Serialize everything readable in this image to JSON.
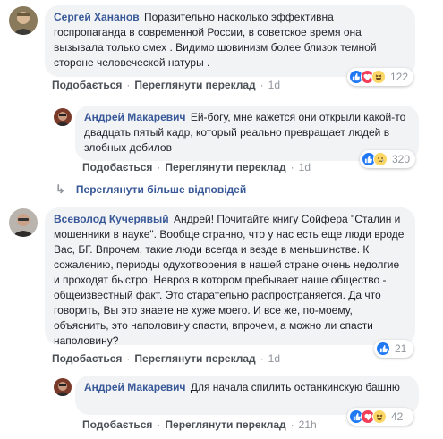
{
  "comments": [
    {
      "author": "Сергей Хананов",
      "text": "Поразительно насколько эффективна госпропаганда в современной России, в советское время она вызывала только смех . Видимо шовинизм более близок темной стороне человеческой натуры .",
      "actions": [
        "Подобається",
        "Переглянути переклад"
      ],
      "time": "1d",
      "reactions": [
        "like",
        "love",
        "haha"
      ],
      "reaction_count": "122"
    },
    {
      "author": "Андрей Макаревич",
      "text": "Ей-богу, мне кажется они открыли какой-то двадцать пятый кадр, который реально превращает людей в злобных дебилов",
      "actions": [
        "Подобається",
        "Переглянути переклад"
      ],
      "time": "1d",
      "reactions": [
        "like",
        "sad"
      ],
      "reaction_count": "320"
    },
    {
      "author": "Всеволод Кучерявый",
      "text": "Андрей! Почитайте книгу Сойфера \"Сталин и мошенники в науке\". Вообще странно, что у нас есть еще люди вроде Вас, БГ. Впрочем, такие люди всегда и везде в меньшинстве. К сожалению, периоды одухотворения в нашей стране очень недолгие и проходят быстро. Невроз в котором пребывает наше общество - общеизвестный факт. Это старательно распространяется. Да что говорить, Вы это знаете не хуже моего. И все же, по-моему, объяснить, это наполовину спасти, впрочем, а можно ли спасти наполовину?",
      "actions": [
        "Подобається",
        "Переглянути переклад"
      ],
      "time": "1d",
      "reactions": [
        "like"
      ],
      "reaction_count": "21"
    },
    {
      "author": "Андрей Макаревич",
      "text": "Для начала спилить останкинскую башню",
      "actions": [
        "Подобається",
        "Переглянути переклад"
      ],
      "time": "21h",
      "reactions": [
        "like",
        "love",
        "haha"
      ],
      "reaction_count": "42"
    }
  ],
  "view_more_replies": "Переглянути більше відповідей",
  "colors": {
    "link": "#385898",
    "bubble": "#f2f3f5",
    "like": "#2078f4",
    "love": "#f33e58",
    "haha": "#fcd766"
  }
}
